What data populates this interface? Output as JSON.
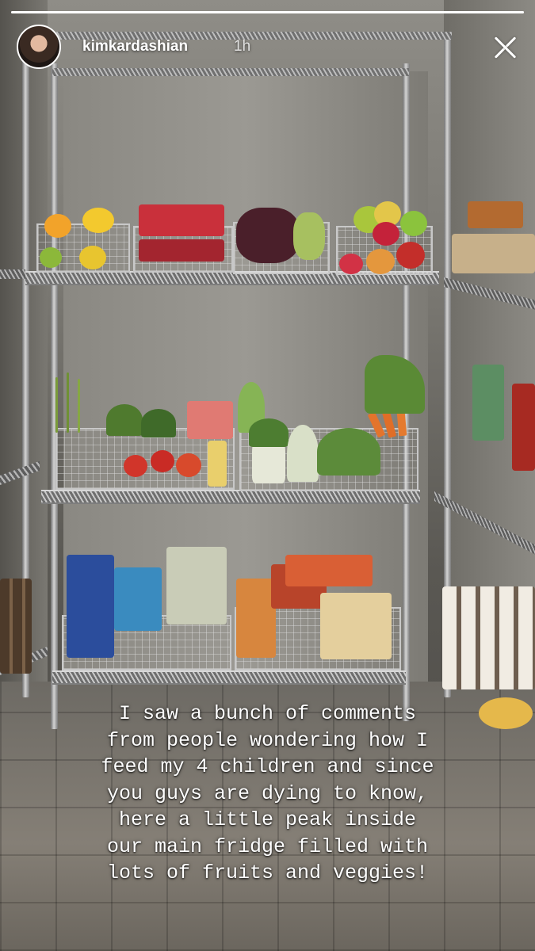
{
  "story": {
    "username": "kimkardashian",
    "time_ago": "1h",
    "progress": 1.0,
    "caption": "I saw a bunch of comments\nfrom people wondering how I\nfeed my 4 children and since\nyou guys are dying to know,\nhere a little peak inside\nour main fridge filled with\nlots of fruits and veggies!"
  },
  "icons": {
    "close": "close-icon",
    "avatar": "profile-avatar"
  },
  "colors": {
    "overlay_text": "#ffffff",
    "progress_track": "rgba(255,255,255,0.45)"
  }
}
